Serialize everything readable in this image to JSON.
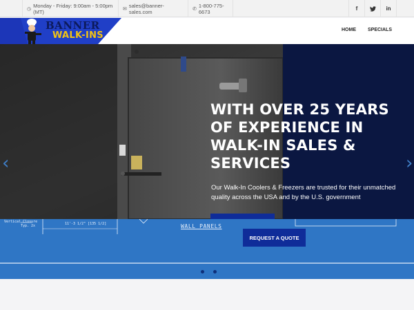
{
  "topbar": {
    "hours": "Monday - Friday: 9:00am - 5:00pm (MT)",
    "email": "sales@banner-sales.com",
    "phone": "1-800-775-6673",
    "social": [
      "f",
      "t",
      "in"
    ]
  },
  "logo": {
    "line1": "BANNER",
    "line2": "WALK-INS"
  },
  "nav": {
    "items": [
      "HOME",
      "SPECIALS"
    ]
  },
  "hero": {
    "title": "WITH OVER 25 YEARS OF EXPERIENCE IN WALK-IN SALES & SERVICES",
    "subtitle": "Our Walk-In Coolers & Freezers are trusted for their unmatched quality across the USA and by the U.S. government"
  },
  "blueprint": {
    "closure_label": "Vertical Closure",
    "closure_sub": "Typ. 2x",
    "dimension": "11'-3 1/2\" [135 1/2]",
    "wall_label": "WALL PANELS"
  },
  "cta": {
    "label": "REQUEST A QUOTE"
  },
  "slider": {
    "slide_count": 2,
    "active_index": 0
  },
  "colors": {
    "brand_navy": "#0b1741",
    "brand_yellow": "#f3c312",
    "cta_blue": "#0f2c99",
    "strip_blue": "#2f76c5",
    "arrow_blue": "#3f7fc8"
  }
}
